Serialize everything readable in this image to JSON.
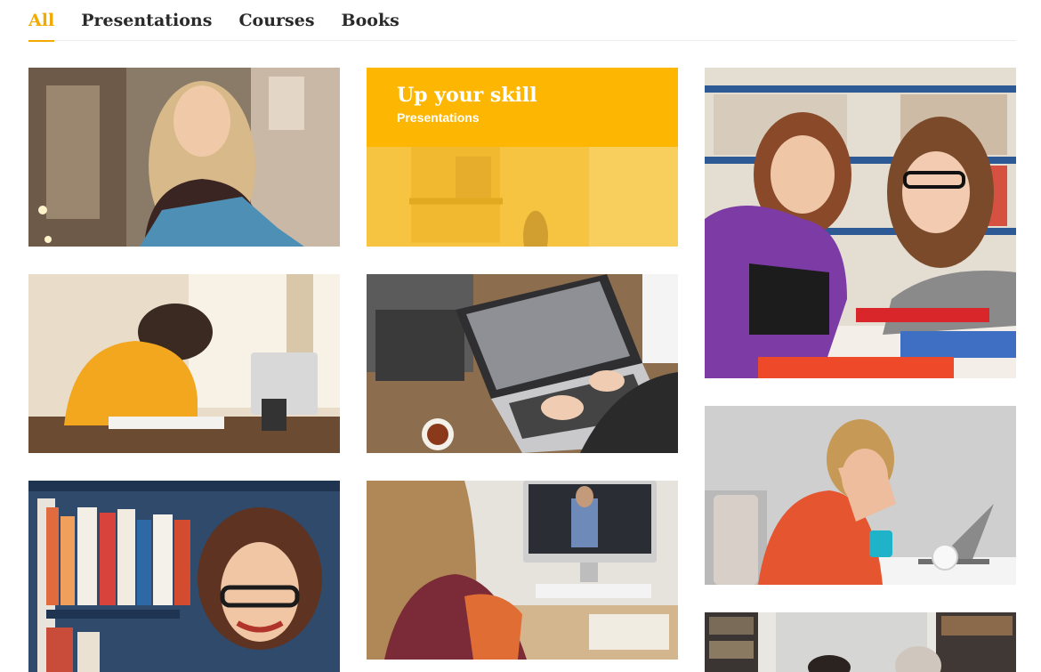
{
  "filters": {
    "tabs": [
      {
        "label": "All",
        "active": true
      },
      {
        "label": "Presentations",
        "active": false
      },
      {
        "label": "Courses",
        "active": false
      },
      {
        "label": "Books",
        "active": false
      }
    ]
  },
  "promo": {
    "title": "Up your skill",
    "subtitle": "Presentations"
  },
  "colors": {
    "accent": "#f2a900",
    "promo_band": "#fdb702"
  }
}
